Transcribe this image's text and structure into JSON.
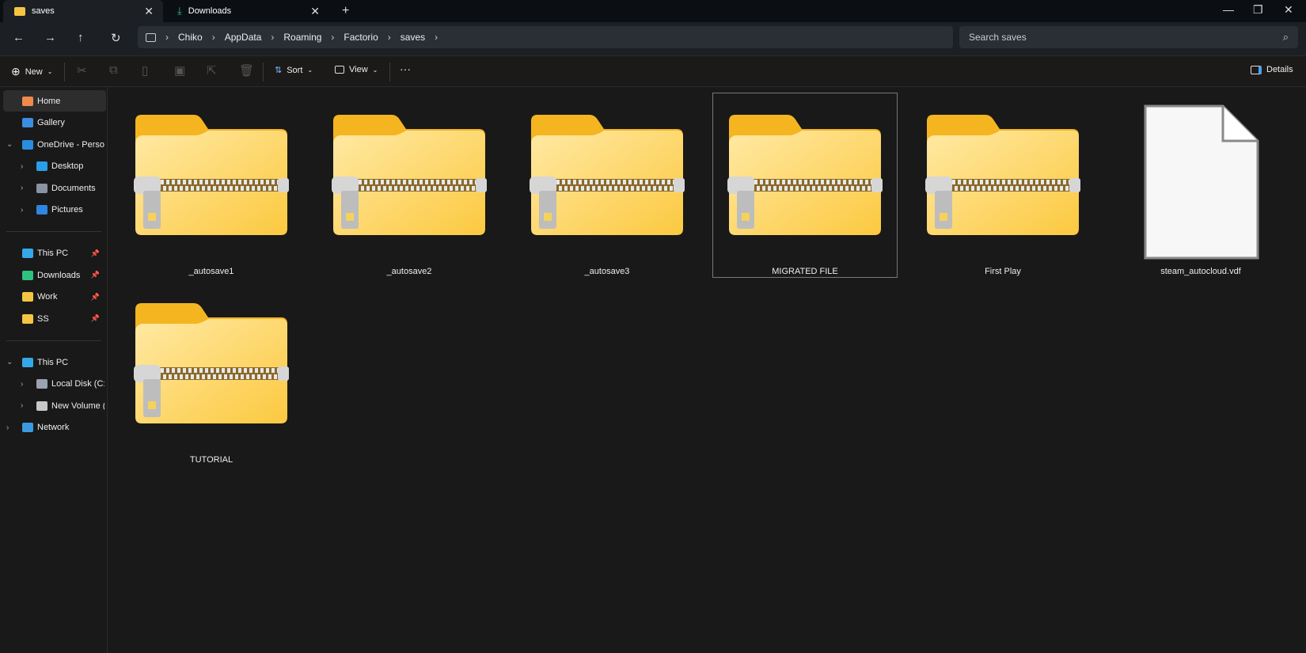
{
  "tabs": [
    {
      "label": "saves",
      "icon": "folder-icon",
      "active": true
    },
    {
      "label": "Downloads",
      "icon": "download-icon",
      "active": false
    }
  ],
  "window": {
    "new_tab": "+",
    "minimize": "—",
    "restore": "❐",
    "close": "✕"
  },
  "breadcrumb": [
    "Chiko",
    "AppData",
    "Roaming",
    "Factorio",
    "saves"
  ],
  "search": {
    "placeholder": "Search saves"
  },
  "toolbar": {
    "new": "New",
    "sort": "Sort",
    "view": "View",
    "more": "···",
    "details": "Details"
  },
  "sidebar": {
    "items": [
      {
        "label": "Home",
        "icon": "home-icon",
        "color": "#f08a4b",
        "indent": 0,
        "selected": true
      },
      {
        "label": "Gallery",
        "icon": "gallery-icon",
        "color": "#3a8fe0",
        "indent": 0
      },
      {
        "label": "OneDrive - Personal",
        "icon": "onedrive-icon",
        "color": "#2b8de0",
        "indent": 0,
        "chevron": "expanded"
      },
      {
        "label": "Desktop",
        "icon": "desktop-icon",
        "color": "#2a9ee8",
        "indent": 1,
        "chevron": "collapsed"
      },
      {
        "label": "Documents",
        "icon": "documents-icon",
        "color": "#8a93a3",
        "indent": 1,
        "chevron": "collapsed"
      },
      {
        "label": "Pictures",
        "icon": "pictures-icon",
        "color": "#2f86e0",
        "indent": 1,
        "chevron": "collapsed"
      },
      {
        "divider": true
      },
      {
        "label": "This PC",
        "icon": "computer-icon",
        "color": "#35a8e8",
        "indent": 0,
        "pinned": true
      },
      {
        "label": "Downloads",
        "icon": "download-icon",
        "color": "#2ec27e",
        "indent": 0,
        "pinned": true
      },
      {
        "label": "Work",
        "icon": "folder-icon",
        "color": "#f5c542",
        "indent": 0,
        "pinned": true
      },
      {
        "label": "SS",
        "icon": "folder-icon",
        "color": "#f5c542",
        "indent": 0,
        "pinned": true
      },
      {
        "divider": true
      },
      {
        "label": "This PC",
        "icon": "computer-icon",
        "color": "#35a8e8",
        "indent": 0,
        "chevron": "expanded"
      },
      {
        "label": "Local Disk (C:)",
        "icon": "drive-icon",
        "color": "#9aa4b0",
        "indent": 1,
        "chevron": "collapsed"
      },
      {
        "label": "New Volume (D:)",
        "icon": "drive-icon",
        "color": "#c8c8c8",
        "indent": 1,
        "chevron": "collapsed"
      },
      {
        "label": "Network",
        "icon": "network-icon",
        "color": "#3a9be0",
        "indent": 0,
        "chevron": "collapsed"
      }
    ]
  },
  "files": [
    {
      "name": "_autosave1",
      "type": "zip"
    },
    {
      "name": "_autosave2",
      "type": "zip"
    },
    {
      "name": "_autosave3",
      "type": "zip"
    },
    {
      "name": "MIGRATED FILE",
      "type": "zip",
      "selected": true
    },
    {
      "name": "First Play",
      "type": "zip"
    },
    {
      "name": "steam_autocloud.vdf",
      "type": "file"
    },
    {
      "name": "TUTORIAL",
      "type": "zip"
    }
  ]
}
